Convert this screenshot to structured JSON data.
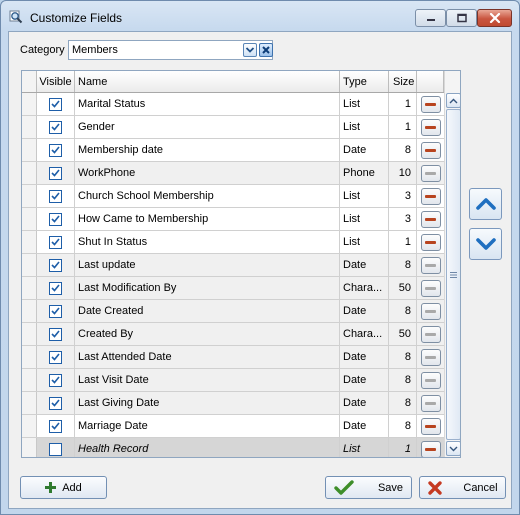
{
  "window": {
    "title": "Customize Fields"
  },
  "category": {
    "label": "Category",
    "value": "Members"
  },
  "grid": {
    "columns": {
      "visible": "Visible",
      "name": "Name",
      "type": "Type",
      "size": "Size"
    },
    "rows": [
      {
        "visible": true,
        "name": "Marital Status",
        "type": "List",
        "size": "1",
        "removable": true
      },
      {
        "visible": true,
        "name": "Gender",
        "type": "List",
        "size": "1",
        "removable": true
      },
      {
        "visible": true,
        "name": "Membership date",
        "type": "Date",
        "size": "8",
        "removable": true
      },
      {
        "visible": true,
        "name": "WorkPhone",
        "type": "Phone",
        "size": "10",
        "removable": false
      },
      {
        "visible": true,
        "name": "Church School Membership",
        "type": "List",
        "size": "3",
        "removable": true
      },
      {
        "visible": true,
        "name": "How Came to Membership",
        "type": "List",
        "size": "3",
        "removable": true
      },
      {
        "visible": true,
        "name": "Shut In Status",
        "type": "List",
        "size": "1",
        "removable": true
      },
      {
        "visible": true,
        "name": "Last update",
        "type": "Date",
        "size": "8",
        "removable": false
      },
      {
        "visible": true,
        "name": "Last Modification By",
        "type": "Chara...",
        "size": "50",
        "removable": false
      },
      {
        "visible": true,
        "name": "Date Created",
        "type": "Date",
        "size": "8",
        "removable": false
      },
      {
        "visible": true,
        "name": "Created By",
        "type": "Chara...",
        "size": "50",
        "removable": false
      },
      {
        "visible": true,
        "name": "Last Attended Date",
        "type": "Date",
        "size": "8",
        "removable": false
      },
      {
        "visible": true,
        "name": "Last Visit Date",
        "type": "Date",
        "size": "8",
        "removable": false
      },
      {
        "visible": true,
        "name": "Last Giving Date",
        "type": "Date",
        "size": "8",
        "removable": false
      },
      {
        "visible": true,
        "name": "Marriage Date",
        "type": "Date",
        "size": "8",
        "removable": true
      },
      {
        "visible": false,
        "name": "Health Record",
        "type": "List",
        "size": "1",
        "removable": true,
        "selected": true
      }
    ]
  },
  "buttons": {
    "add": "Add",
    "save": "Save",
    "cancel": "Cancel"
  },
  "colors": {
    "remove_active": "#b8441f",
    "remove_inactive": "#a9a9a9",
    "arrow_blue": "#1f6fc0",
    "check_blue": "#1e5ea8"
  },
  "icons": {
    "title": "magnifier-icon",
    "move_up": "chevron-up-icon",
    "move_down": "chevron-down-icon",
    "add": "plus-icon",
    "save": "checkmark-icon",
    "cancel": "x-icon"
  }
}
